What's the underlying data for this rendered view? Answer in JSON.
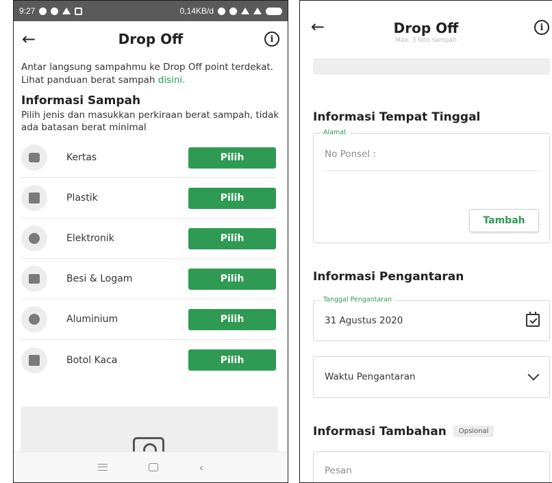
{
  "left": {
    "status_bar": {
      "time": "9:27",
      "network_speed": "0,14KB/d"
    },
    "header": {
      "title": "Drop Off"
    },
    "intro": {
      "line1": "Antar langsung sampahmu ke Drop Off point terdekat.",
      "line2_prefix": "Lihat panduan berat sampah ",
      "link_text": "disini."
    },
    "section": {
      "title": "Informasi Sampah",
      "subtitle": "Pilih jenis dan masukkan perkiraan berat sampah, tidak ada batasan berat minimal"
    },
    "waste_types": [
      {
        "label": "Kertas",
        "icon": "paper-icon",
        "button": "Pilih"
      },
      {
        "label": "Plastik",
        "icon": "plastic-icon",
        "button": "Pilih"
      },
      {
        "label": "Elektronik",
        "icon": "electronic-icon",
        "button": "Pilih"
      },
      {
        "label": "Besi & Logam",
        "icon": "metal-icon",
        "button": "Pilih"
      },
      {
        "label": "Aluminium",
        "icon": "aluminium-icon",
        "button": "Pilih"
      },
      {
        "label": "Botol Kaca",
        "icon": "glass-bottle-icon",
        "button": "Pilih"
      }
    ],
    "colors": {
      "accent": "#2e9a54",
      "icon_bg": "#ececec"
    }
  },
  "right": {
    "header": {
      "title": "Drop Off"
    },
    "photo_hint": "Max. 3 foto sampah",
    "residence": {
      "title": "Informasi Tempat Tinggal",
      "legend": "Alamat",
      "phone_label": "No Ponsel :",
      "add_button": "Tambah"
    },
    "delivery": {
      "title": "Informasi Pengantaran",
      "date_legend": "Tanggal Pengantaran",
      "date_value": "31 Agustus 2020",
      "time_placeholder": "Waktu Pengantaran"
    },
    "additional": {
      "title": "Informasi Tambahan",
      "badge": "Opsional",
      "message_placeholder": "Pesan"
    }
  }
}
